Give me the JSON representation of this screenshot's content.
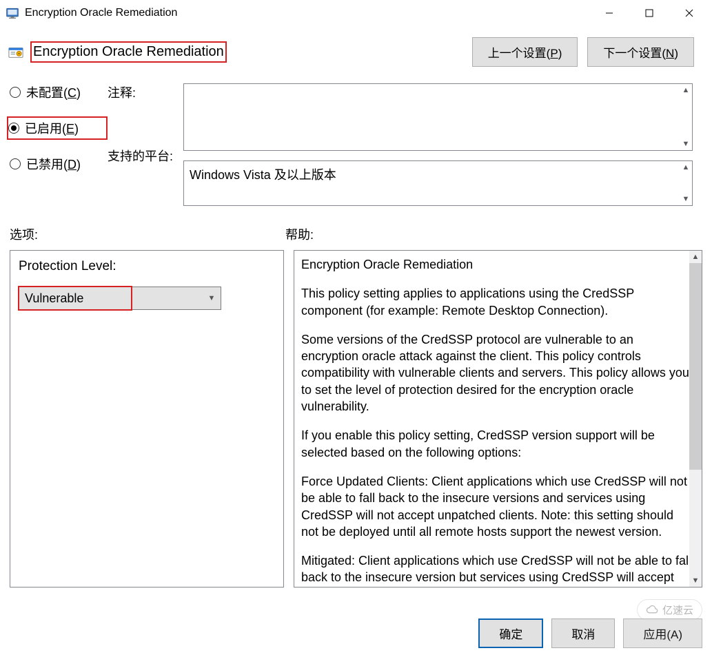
{
  "window_title": "Encryption Oracle Remediation",
  "policy_title": "Encryption Oracle Remediation",
  "nav": {
    "prev": "上一个设置(",
    "prev_key": "P",
    "next": "下一个设置(",
    "next_key": "N",
    "close_paren": ")"
  },
  "radios": {
    "not_configured": "未配置(",
    "nc_key": "C",
    "enabled": "已启用(",
    "en_key": "E",
    "disabled": "已禁用(",
    "dis_key": "D",
    "close": ")",
    "selected": "enabled"
  },
  "labels": {
    "comment": "注释:",
    "supported": "支持的平台:",
    "options": "选项:",
    "help": "帮助:"
  },
  "supported_text": "Windows Vista 及以上版本",
  "options": {
    "protection_label": "Protection Level:",
    "protection_value": "Vulnerable"
  },
  "help": {
    "h1": "Encryption Oracle Remediation",
    "p1": "This policy setting applies to applications using the CredSSP component (for example: Remote Desktop Connection).",
    "p2": "Some versions of the CredSSP protocol are vulnerable to an encryption oracle attack against the client.  This policy controls compatibility with vulnerable clients and servers.  This policy allows you to set the level of protection desired for the encryption oracle vulnerability.",
    "p3": "If you enable this policy setting, CredSSP version support will be selected based on the following options:",
    "p4": "Force Updated Clients: Client applications which use CredSSP will not be able to fall back to the insecure versions and services using CredSSP will not accept unpatched clients. Note: this setting should not be deployed until all remote hosts support the newest version.",
    "p5": "Mitigated: Client applications which use CredSSP will not be able to fall back to the insecure version but services using CredSSP will accept"
  },
  "buttons": {
    "ok": "确定",
    "cancel": "取消",
    "apply": "应用(A)"
  },
  "watermark": "亿速云"
}
